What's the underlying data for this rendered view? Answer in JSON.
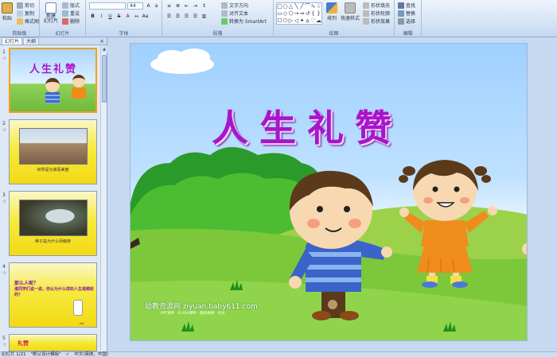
{
  "ribbon": {
    "clipboard": {
      "paste": "粘贴",
      "cut": "剪切",
      "copy": "复制",
      "format_painter": "格式刷",
      "label": "剪贴板"
    },
    "slides": {
      "new_slide": "新建\n幻灯片",
      "layout": "版式",
      "reset": "重设",
      "delete": "删除",
      "label": "幻灯片"
    },
    "font": {
      "font_name": "",
      "font_size": "44",
      "label": "字体"
    },
    "paragraph": {
      "text_direction": "文字方向",
      "align_text": "对齐文本",
      "smartart": "转换为 SmartArt",
      "label": "段落"
    },
    "drawing": {
      "arrange": "排列",
      "quick_styles": "快速样式",
      "shape_fill": "形状填充",
      "shape_outline": "形状轮廓",
      "shape_effects": "形状效果",
      "label": "绘图"
    },
    "editing": {
      "find": "查找",
      "replace": "替换",
      "select": "选择",
      "label": "编辑"
    }
  },
  "panel": {
    "tab_slides": "幻灯片",
    "tab_outline": "大纲",
    "close": "×",
    "thumbnails": [
      {
        "num": "1",
        "title": "人生礼赞"
      },
      {
        "num": "2",
        "caption": "世界是为谁而美丽"
      },
      {
        "num": "3",
        "caption": "种子是为什么而萌芽"
      },
      {
        "num": "4",
        "text1": "那么人呢？",
        "text2": "谁同学们说一说，你认为什么样的人生是精彩的？"
      },
      {
        "num": "5",
        "text1": "礼赞"
      }
    ]
  },
  "slide": {
    "title": "人生礼赞",
    "watermark_main": "幼教资源网 ziyuan.baby611.com",
    "watermark_sub": "PPT课件 · FLASH课件 · 教育故事 · 论文"
  },
  "status": {
    "slide_pos": "幻灯片 1/21",
    "theme": "\"默认设计模板\"",
    "language": "中文(简体，中国)"
  },
  "colors": {
    "title_purple": "#a815c9",
    "thumb_yellow": "#f6ea3c",
    "ribbon_bg": "#d6e4f5",
    "selection_orange": "#f2a01c"
  }
}
